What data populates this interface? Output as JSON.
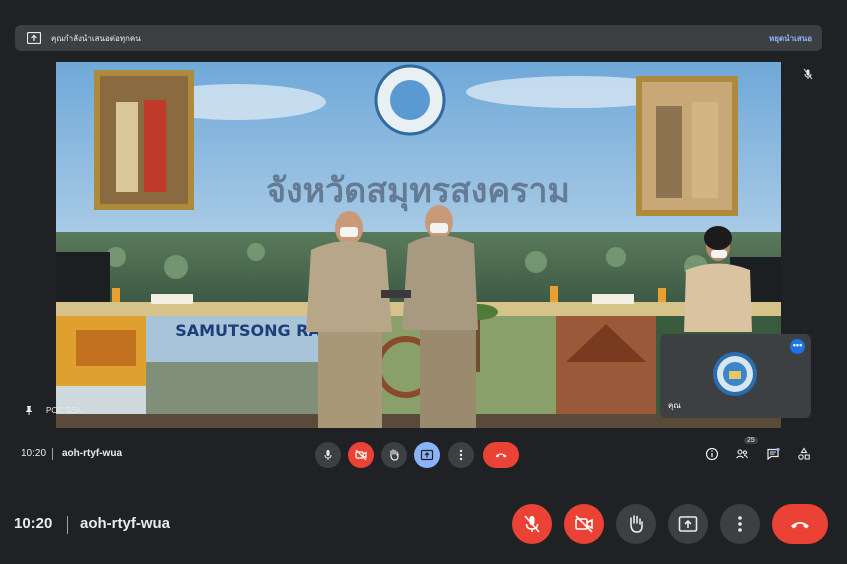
{
  "banner": {
    "message": "คุณกำลังนำเสนอต่อทุกคน",
    "stop_label": "หยุดนำเสนอ"
  },
  "main_video": {
    "presenter_name": "POC SSK",
    "backdrop_title": "จังหวัดสมุทรสงคราม",
    "stand_text": "SAMUTSONG  RAM"
  },
  "self_tile": {
    "name": "คุณ"
  },
  "inner_bar": {
    "time": "10:20",
    "meeting_code": "aoh-rtyf-wua",
    "participant_count": "25"
  },
  "bottom_bar": {
    "time": "10:20",
    "meeting_code": "aoh-rtyf-wua"
  },
  "icons": {
    "present": "present-to-all-icon",
    "mic_off": "mic-off-icon",
    "cam_off": "videocam-off-icon",
    "hand": "raise-hand-icon",
    "more": "more-vert-icon",
    "end_call": "call-end-icon",
    "info": "info-icon",
    "people": "people-icon",
    "chat": "chat-icon",
    "activities": "activities-icon"
  },
  "colors": {
    "background": "#202124",
    "surface": "#3c4043",
    "danger": "#ea4335",
    "accent": "#8ab4f8",
    "primary": "#1a73e8"
  }
}
